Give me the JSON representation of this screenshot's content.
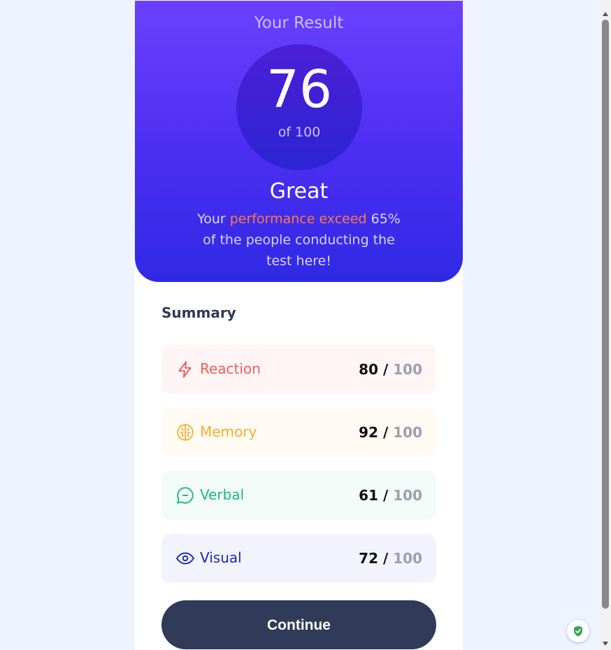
{
  "result": {
    "title": "Your Result",
    "score": "76",
    "score_max_text": "of 100",
    "grade": "Great",
    "message_pre": "Your ",
    "message_highlight": "performance exceed",
    "message_post": " 65% of the people conducting the test here!"
  },
  "summary": {
    "title": "Summary",
    "items": [
      {
        "label": "Reaction",
        "score": "80",
        "sep": " / ",
        "max": "100",
        "icon": "lightning-icon",
        "color": "#f25c5c",
        "bg": "#fff5f5"
      },
      {
        "label": "Memory",
        "score": "92",
        "sep": " / ",
        "max": "100",
        "icon": "brain-icon",
        "color": "#f5ae2b",
        "bg": "#fffaf3"
      },
      {
        "label": "Verbal",
        "score": "61",
        "sep": " / ",
        "max": "100",
        "icon": "chat-icon",
        "color": "#1fb789",
        "bg": "#f2fbf8"
      },
      {
        "label": "Visual",
        "score": "72",
        "sep": " / ",
        "max": "100",
        "icon": "eye-icon",
        "color": "#1a29b8",
        "bg": "#f3f3fd"
      }
    ]
  },
  "actions": {
    "continue_label": "Continue"
  },
  "colors": {
    "hero_gradient_start": "#6a40ff",
    "hero_gradient_end": "#2f29e4",
    "highlight": "#ff7a45",
    "button": "#303b59"
  }
}
